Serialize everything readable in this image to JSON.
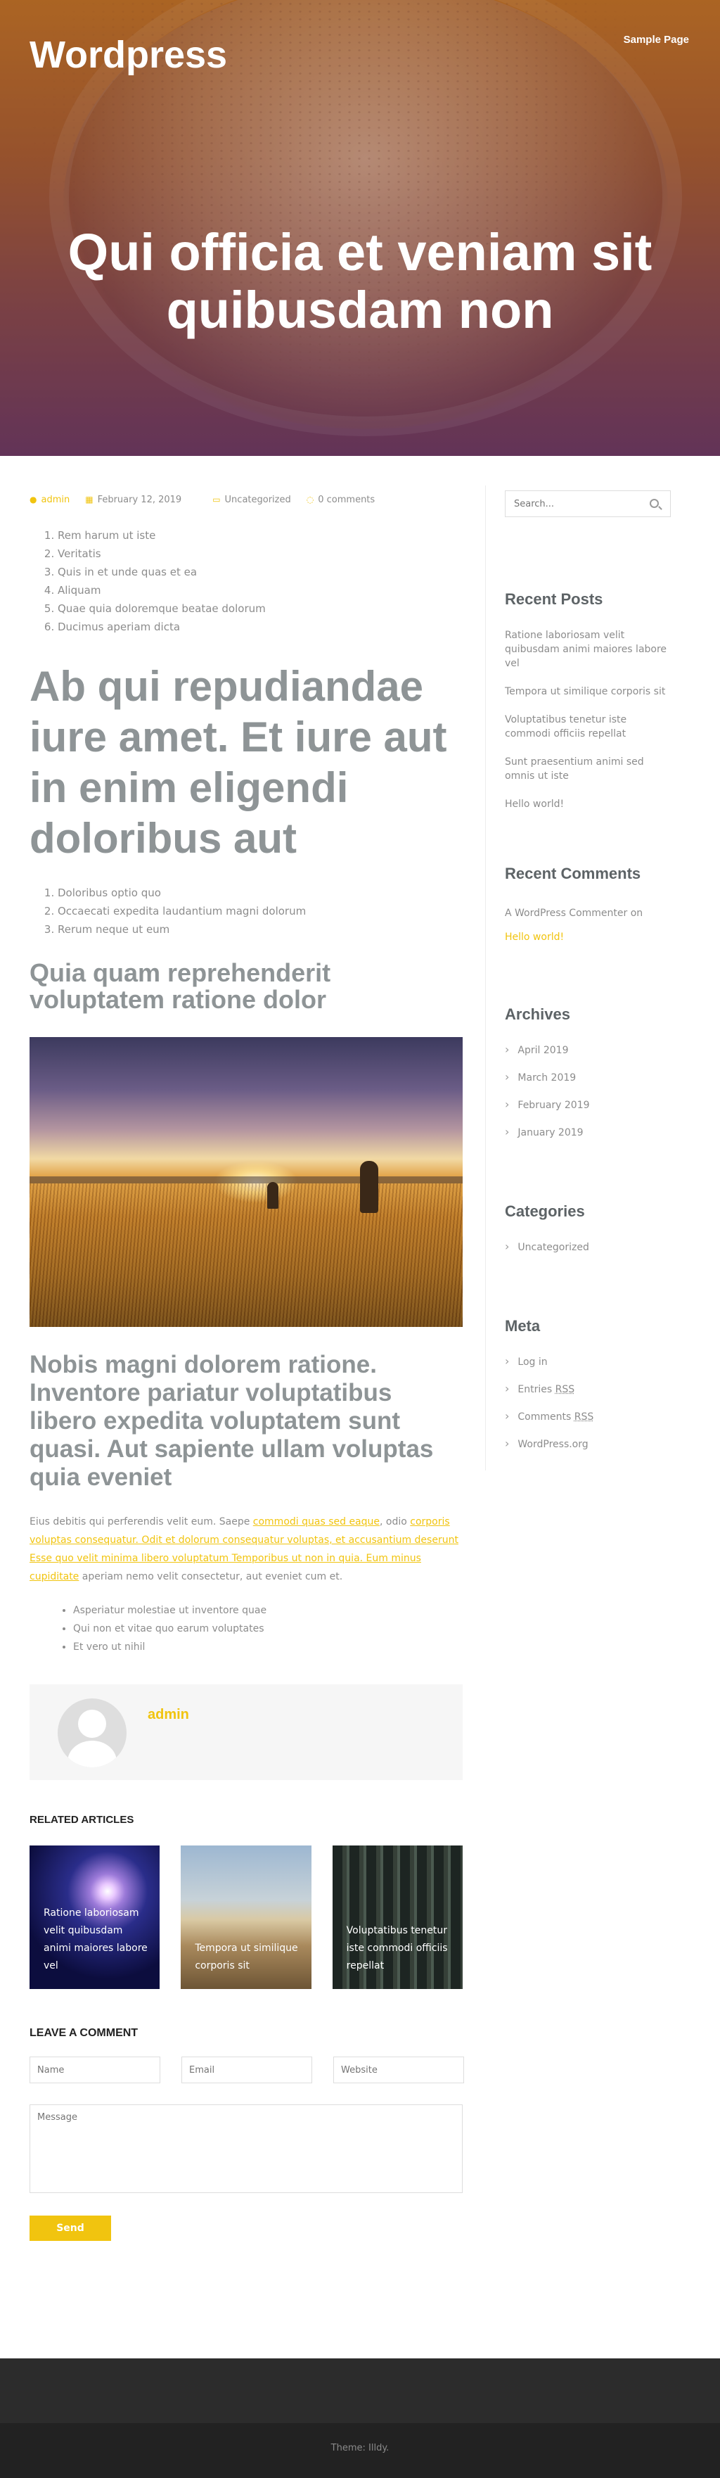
{
  "site": {
    "title": "Wordpress",
    "nav": [
      "Sample Page"
    ]
  },
  "hero": {
    "title": "Qui officia et veniam sit quibusdam non"
  },
  "post": {
    "meta": {
      "author": "admin",
      "date": "February 12, 2019",
      "category": "Uncategorized",
      "comments": "0 comments"
    },
    "list1": [
      "Rem harum ut iste",
      "Veritatis",
      "Quis in et unde quas et ea",
      "Aliquam",
      "Quae quia doloremque beatae dolorum",
      "Ducimus aperiam dicta"
    ],
    "heading1": "Ab qui repudiandae iure amet. Et iure aut in enim eligendi doloribus aut",
    "list2": [
      "Doloribus optio quo",
      "Occaecati expedita laudantium magni dolorum",
      "Rerum neque ut eum"
    ],
    "heading2": "Quia quam reprehenderit voluptatem ratione dolor",
    "heading3": "Nobis magni dolorem ratione. Inventore pariatur voluptatibus libero expedita voluptatem sunt quasi. Aut sapiente ullam voluptas quia eveniet",
    "paragraph": {
      "t1": "Eius debitis qui perferendis velit eum. Saepe ",
      "l1": "commodi quas sed eaque",
      "t2": ", odio ",
      "l2": "corporis voluptas consequatur. Odit et dolorum consequatur voluptas, et accusantium deserunt",
      "t3": " ",
      "l3": "Esse quo velit minima libero voluptatum Temporibus ut non in quia. Eum minus cupiditate",
      "t4": " aperiam nemo velit consectetur, aut eveniet cum et."
    },
    "bullets": [
      "Asperiatur molestiae ut inventore quae",
      "Qui non et vitae quo earum voluptates",
      "Et vero ut nihil"
    ]
  },
  "author_box": {
    "name": "admin"
  },
  "related": {
    "title": "RELATED ARTICLES",
    "items": [
      "Ratione laboriosam velit quibusdam animi maiores labore vel",
      "Tempora ut similique corporis sit",
      "Voluptatibus tenetur iste commodi officiis repellat"
    ]
  },
  "comment_form": {
    "title": "LEAVE A COMMENT",
    "name_placeholder": "Name",
    "email_placeholder": "Email",
    "website_placeholder": "Website",
    "message_placeholder": "Message",
    "send_label": "Send"
  },
  "sidebar": {
    "search_placeholder": "Search...",
    "recent_posts": {
      "title": "Recent Posts",
      "items": [
        "Ratione laboriosam velit quibusdam animi maiores labore vel",
        "Tempora ut similique corporis sit",
        "Voluptatibus tenetur iste commodi officiis repellat",
        "Sunt praesentium animi sed omnis ut iste",
        "Hello world!"
      ]
    },
    "recent_comments": {
      "title": "Recent Comments",
      "author": "A WordPress Commenter",
      "on": "on",
      "post": "Hello world!"
    },
    "archives": {
      "title": "Archives",
      "items": [
        "April 2019",
        "March 2019",
        "February 2019",
        "January 2019"
      ]
    },
    "categories": {
      "title": "Categories",
      "items": [
        "Uncategorized"
      ]
    },
    "meta": {
      "title": "Meta",
      "login": "Log in",
      "entries": "Entries",
      "comments": "Comments",
      "rss": "RSS",
      "wp": "WordPress.org"
    }
  },
  "footer": {
    "text": "Theme: Illdy."
  },
  "colors": {
    "accent": "#f1c40f",
    "heading": "#8e9496",
    "footer_dark": "#222222"
  }
}
